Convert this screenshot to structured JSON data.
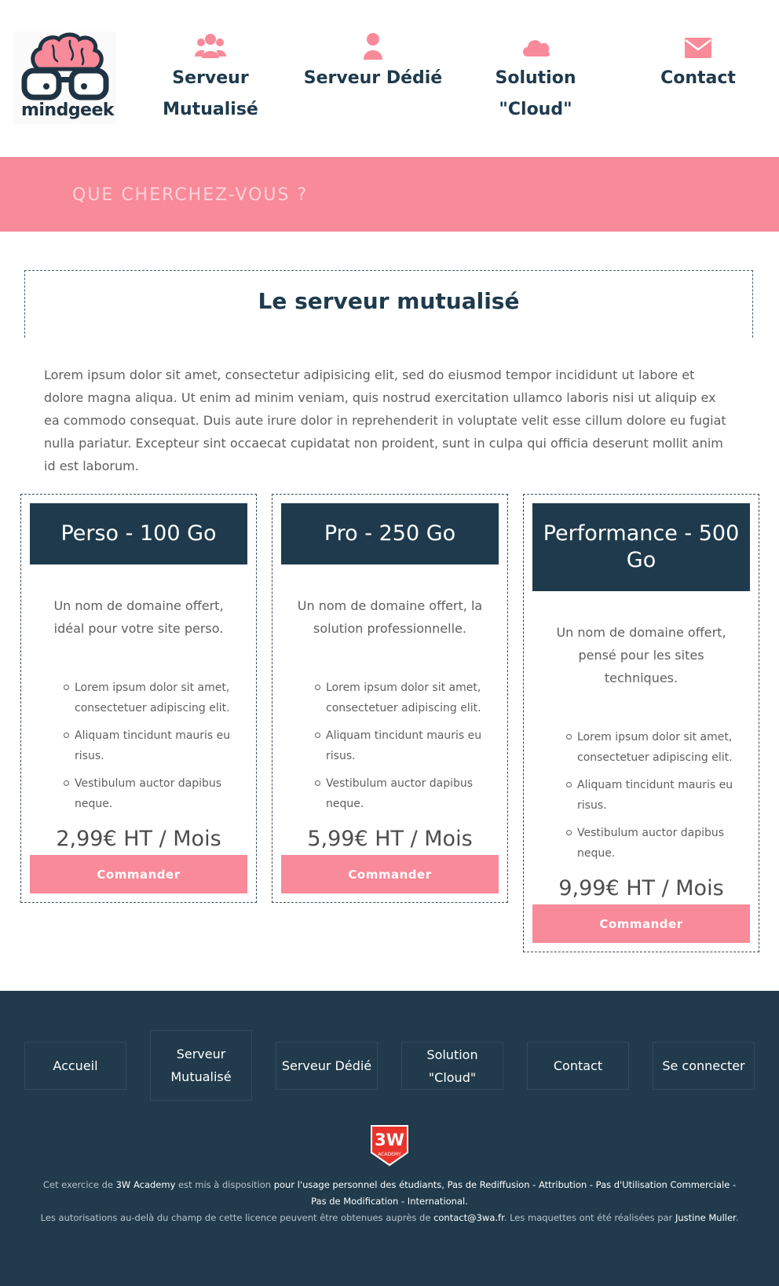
{
  "brand": {
    "name": "mindgeek",
    "colors": {
      "navy": "#1f3a4d",
      "pink": "#f98a99",
      "footer_bg": "#213b4c"
    }
  },
  "nav": {
    "items": [
      {
        "label_line1": "Serveur",
        "label_line2": "Mutualisé",
        "icon": "users-icon"
      },
      {
        "label_line1": "Serveur Dédié",
        "label_line2": "",
        "icon": "user-icon"
      },
      {
        "label_line1": "Solution",
        "label_line2": "\"Cloud\"",
        "icon": "cloud-icon"
      },
      {
        "label_line1": "Contact",
        "label_line2": "",
        "icon": "envelope-icon"
      }
    ]
  },
  "search": {
    "placeholder": "QUE CHERCHEZ-VOUS ?"
  },
  "section": {
    "title": "Le serveur mutualisé",
    "intro": "Lorem ipsum dolor sit amet, consectetur adipisicing elit, sed do eiusmod tempor incididunt ut labore et dolore magna aliqua. Ut enim ad minim veniam, quis nostrud exercitation ullamco laboris nisi ut aliquip ex ea commodo consequat. Duis aute irure dolor in reprehenderit in voluptate velit esse cillum dolore eu fugiat nulla pariatur. Excepteur sint occaecat cupidatat non proident, sunt in culpa qui officia deserunt mollit anim id est laborum."
  },
  "plans": [
    {
      "name": "Perso - 100 Go",
      "description": "Un nom de domaine offert, idéal pour votre site perso.",
      "features": [
        "Lorem ipsum dolor sit amet, consectetuer adipiscing elit.",
        "Aliquam tincidunt mauris eu risus.",
        "Vestibulum auctor dapibus neque."
      ],
      "price": "2,99€ HT / Mois",
      "button": "Commander"
    },
    {
      "name": "Pro - 250 Go",
      "description": "Un nom de domaine offert, la solution professionnelle.",
      "features": [
        "Lorem ipsum dolor sit amet, consectetuer adipiscing elit.",
        "Aliquam tincidunt mauris eu risus.",
        "Vestibulum auctor dapibus neque."
      ],
      "price": "5,99€ HT / Mois",
      "button": "Commander"
    },
    {
      "name": "Performance - 500 Go",
      "description": "Un nom de domaine offert, pensé pour les sites techniques.",
      "features": [
        "Lorem ipsum dolor sit amet, consectetuer adipiscing elit.",
        "Aliquam tincidunt mauris eu risus.",
        "Vestibulum auctor dapibus neque."
      ],
      "price": "9,99€ HT / Mois",
      "button": "Commander"
    }
  ],
  "footer": {
    "links": [
      "Accueil",
      "Serveur Mutualisé",
      "Serveur Dédié",
      "Solution \"Cloud\"",
      "Contact",
      "Se connecter"
    ],
    "badge": {
      "top": "3W",
      "bottom": "ACADEMY"
    },
    "license": {
      "p1": "Cet exercice de ",
      "academy": "3W Academy",
      "p2": " est mis à disposition ",
      "terms": "pour l'usage personnel des étudiants, Pas de Rediffusion - Attribution - Pas d'Utilisation Commerciale - Pas de Modification - International.",
      "p3": "Les autorisations au-delà du champ de cette licence peuvent être obtenues auprès de ",
      "email": "contact@3wa.fr",
      "p4": ". Les maquettes ont été réalisées par ",
      "author": "Justine Muller",
      "p5": "."
    }
  }
}
